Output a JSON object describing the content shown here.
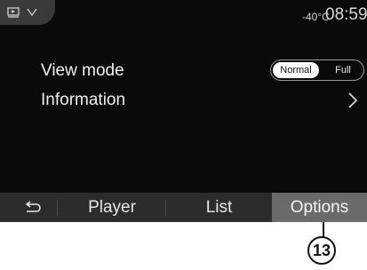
{
  "status": {
    "temperature": "-40°C",
    "time": "08:59"
  },
  "options": {
    "view_mode_label": "View mode",
    "view_mode_toggle": {
      "selected": "Normal",
      "other": "Full"
    },
    "information_label": "Information"
  },
  "bottom_nav": {
    "player": "Player",
    "list": "List",
    "options": "Options",
    "active": "Options"
  },
  "callout": {
    "number": "13"
  },
  "icons": {
    "source_menu": "media-source-icon",
    "menu_chevron": "chevron-down-icon",
    "information_arrow": "chevron-right-icon",
    "back": "back-arrow-icon"
  },
  "colors": {
    "background": "#0a0a0a",
    "bar": "#2c2c2c",
    "active_tab": "#6a6a6a",
    "text": "#f0f0f0"
  }
}
